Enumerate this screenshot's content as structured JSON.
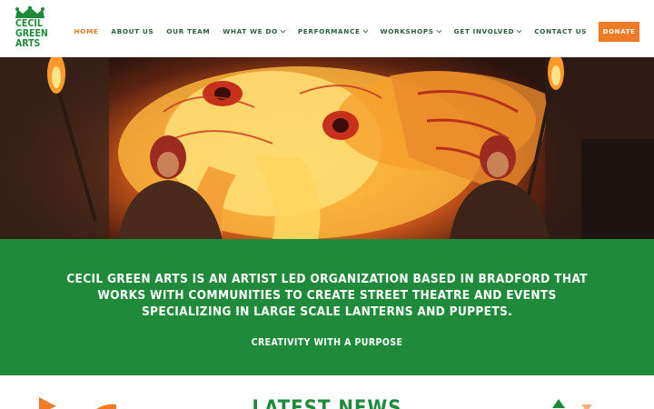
{
  "logo": {
    "lines": [
      "CECIL",
      "GREEN",
      "ARTS"
    ],
    "icon": "crown-icon"
  },
  "nav": {
    "items": [
      {
        "label": "HOME",
        "active": true,
        "dropdown": false
      },
      {
        "label": "ABOUT US",
        "active": false,
        "dropdown": false
      },
      {
        "label": "OUR TEAM",
        "active": false,
        "dropdown": false
      },
      {
        "label": "WHAT WE DO",
        "active": false,
        "dropdown": true
      },
      {
        "label": "PERFORMANCE",
        "active": false,
        "dropdown": true
      },
      {
        "label": "WORKSHOPS",
        "active": false,
        "dropdown": true
      },
      {
        "label": "GET INVOLVED",
        "active": false,
        "dropdown": true
      },
      {
        "label": "CONTACT US",
        "active": false,
        "dropdown": false
      }
    ],
    "donate_label": "DONATE"
  },
  "hero": {
    "slides": 2,
    "active_slide": 0
  },
  "band": {
    "mission": "CECIL GREEN ARTS IS AN ARTIST LED ORGANIZATION BASED IN BRADFORD THAT WORKS WITH COMMUNITIES TO CREATE STREET THEATRE AND EVENTS SPECIALIZING IN LARGE SCALE LANTERNS AND PUPPETS.",
    "tagline": "CREATIVITY WITH A PURPOSE"
  },
  "news": {
    "title": "LATEST NEWS"
  },
  "colors": {
    "brand_green": "#1f8a3a",
    "accent_orange": "#ee7a25",
    "nav_text": "#2c5e3a"
  }
}
